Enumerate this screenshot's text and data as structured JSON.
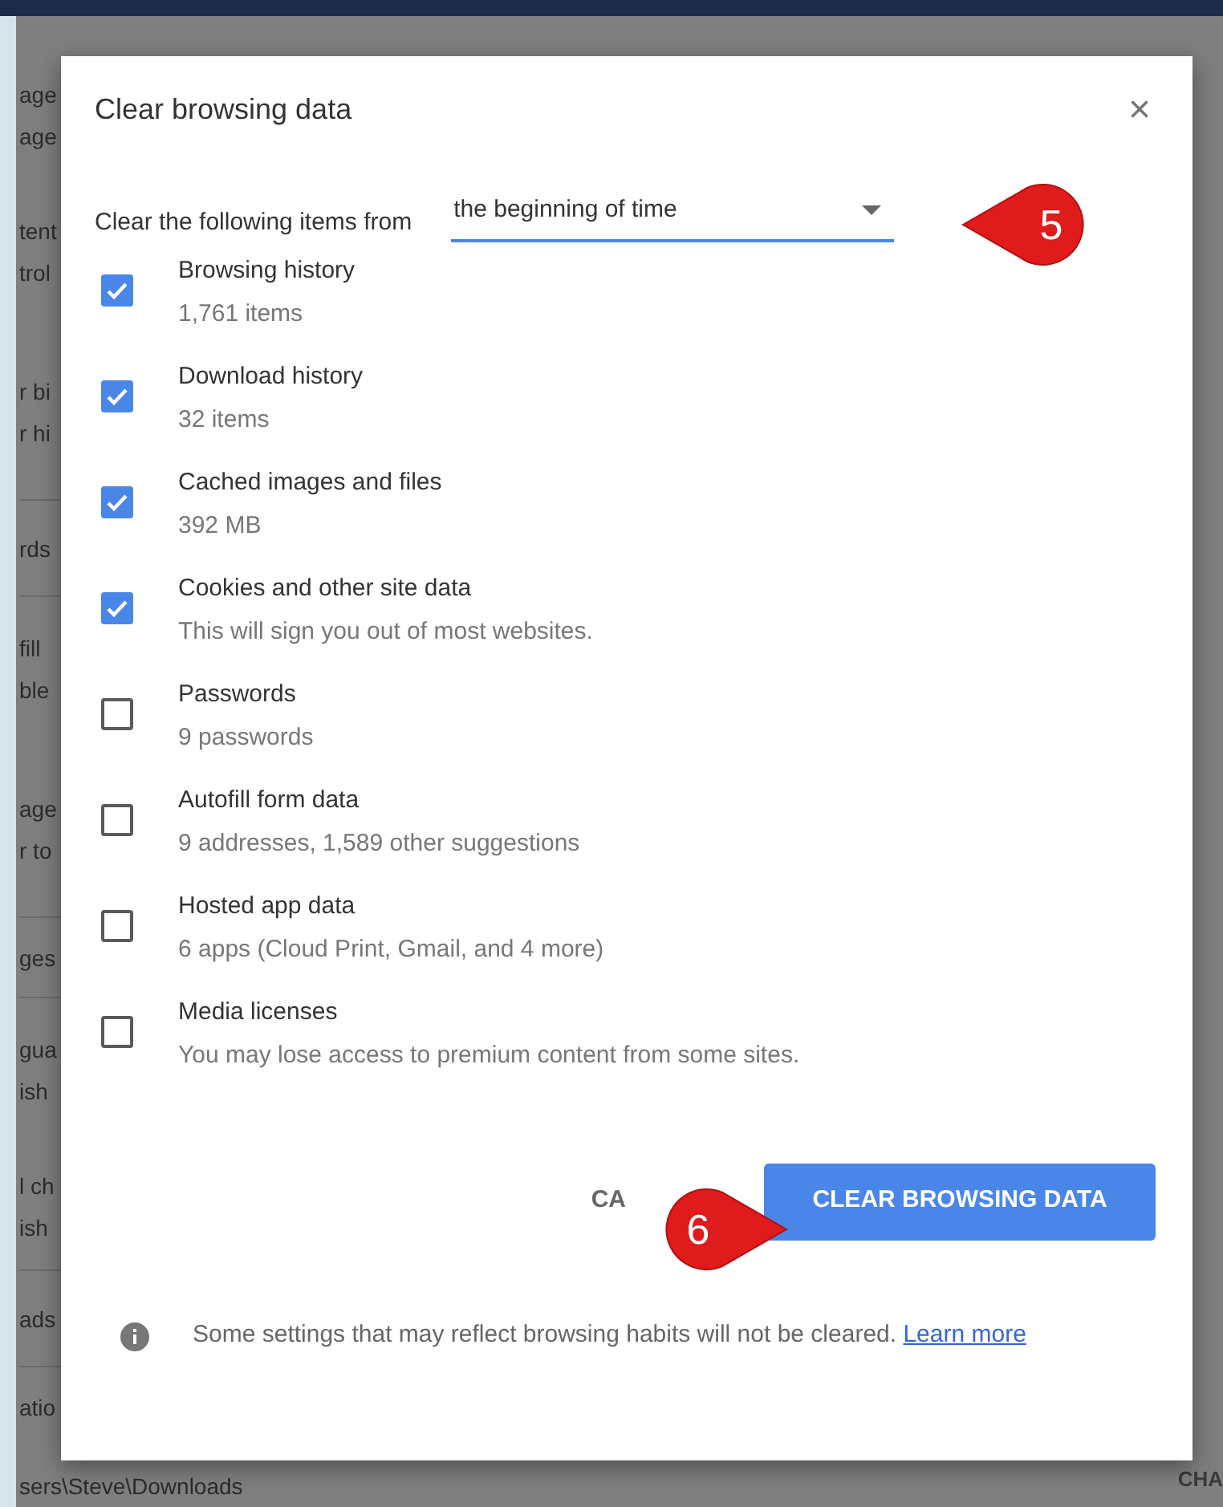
{
  "background_page": {
    "fragment_groups": [
      {
        "lines": [
          "age",
          "age"
        ]
      },
      {
        "lines": [
          "tent",
          "trol"
        ]
      },
      {
        "lines": [
          "r bi",
          "r hi"
        ]
      },
      {
        "lines": [
          "rds"
        ]
      },
      {
        "lines": [
          "fill",
          "ble"
        ]
      },
      {
        "lines": [
          "age",
          "r to"
        ]
      },
      {
        "lines": [
          "ges"
        ]
      },
      {
        "lines": [
          "gua",
          "ish"
        ]
      },
      {
        "lines": [
          "l ch",
          "ish"
        ]
      },
      {
        "lines": [
          "ads"
        ]
      },
      {
        "lines": [
          "atio"
        ]
      }
    ],
    "path_line": "sers\\Steve\\Downloads",
    "side_button": "CHA"
  },
  "dialog": {
    "title": "Clear browsing data",
    "close": "×",
    "time_range": {
      "label": "Clear the following items from",
      "value": "the beginning of time"
    },
    "items": [
      {
        "title": "Browsing history",
        "detail": "1,761 items",
        "checked": true
      },
      {
        "title": "Download history",
        "detail": "32 items",
        "checked": true
      },
      {
        "title": "Cached images and files",
        "detail": "392 MB",
        "checked": true
      },
      {
        "title": "Cookies and other site data",
        "detail": "This will sign you out of most websites.",
        "checked": true
      },
      {
        "title": "Passwords",
        "detail": "9 passwords",
        "checked": false
      },
      {
        "title": "Autofill form data",
        "detail": "9 addresses, 1,589 other suggestions",
        "checked": false
      },
      {
        "title": "Hosted app data",
        "detail": "6 apps (Cloud Print, Gmail, and 4 more)",
        "checked": false
      },
      {
        "title": "Media licenses",
        "detail": "You may lose access to premium content from some sites.",
        "checked": false
      }
    ],
    "cancel_button": "CA",
    "confirm_button": "CLEAR BROWSING DATA",
    "footer": {
      "text": "Some settings that may reflect browsing habits will not be cleared.",
      "link": "Learn more"
    }
  },
  "callouts": [
    {
      "number": "5",
      "kind": "leftward"
    },
    {
      "number": "6",
      "kind": "rightward"
    }
  ]
}
